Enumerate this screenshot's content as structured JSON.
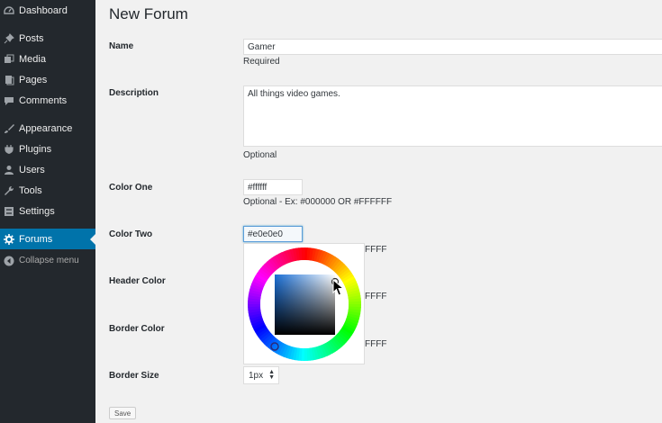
{
  "sidebar": {
    "items": [
      {
        "label": "Dashboard",
        "icon": "dashboard-icon"
      },
      {
        "label": "Posts",
        "icon": "pin-icon"
      },
      {
        "label": "Media",
        "icon": "media-icon"
      },
      {
        "label": "Pages",
        "icon": "pages-icon"
      },
      {
        "label": "Comments",
        "icon": "comment-icon"
      },
      {
        "label": "Appearance",
        "icon": "brush-icon"
      },
      {
        "label": "Plugins",
        "icon": "plug-icon"
      },
      {
        "label": "Users",
        "icon": "user-icon"
      },
      {
        "label": "Tools",
        "icon": "wrench-icon"
      },
      {
        "label": "Settings",
        "icon": "settings-icon"
      },
      {
        "label": "Forums",
        "icon": "gear-icon",
        "active": true
      }
    ],
    "collapse_label": "Collapse menu"
  },
  "page": {
    "title": "New Forum"
  },
  "form": {
    "name": {
      "label": "Name",
      "value": "Gamer",
      "help": "Required"
    },
    "description": {
      "label": "Description",
      "value": "All things video games.",
      "help": "Optional"
    },
    "color_one": {
      "label": "Color One",
      "value": "#ffffff",
      "help": "Optional - Ex: #000000 OR #FFFFFF"
    },
    "color_two": {
      "label": "Color Two",
      "value": "#e0e0e0",
      "help_tail": "FFFF"
    },
    "header_color": {
      "label": "Header Color",
      "help_tail": "FFFF"
    },
    "border_color": {
      "label": "Border Color",
      "help_tail": "FFFF"
    },
    "border_size": {
      "label": "Border Size",
      "value": "1px"
    },
    "save_label": "Save"
  },
  "colors": {
    "sidebar_bg": "#23282d",
    "active_bg": "#0073aa",
    "page_bg": "#f1f1f1",
    "input_focus": "#5b9dd9"
  }
}
